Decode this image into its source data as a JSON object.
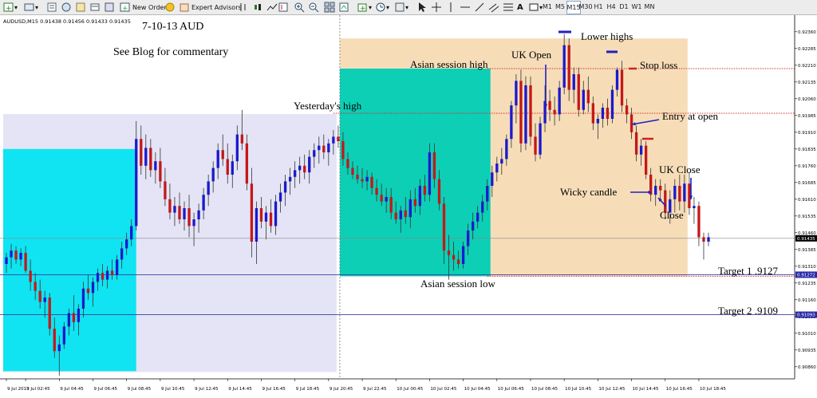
{
  "toolbar": {
    "new_order": "New Order",
    "expert_advisors": "Expert Advisors",
    "timeframes": [
      "M1",
      "M5",
      "M15",
      "M30",
      "H1",
      "H4",
      "D1",
      "W1",
      "MN"
    ],
    "active_timeframe": "M15"
  },
  "chart": {
    "symbol_info": "AUDUSD,M15  0.91438 0.91456 0.91433 0.91435",
    "date_title": "7-10-13  AUD",
    "blog_note": "See Blog for commentary",
    "current_price": "0.91435",
    "target1_price_label": "0.91272",
    "target2_price_label": "0.91093"
  },
  "chart_data": {
    "type": "candlestick",
    "price_axis_ticks": [
      "0.92360",
      "0.92285",
      "0.92210",
      "0.92135",
      "0.92060",
      "0.91985",
      "0.91910",
      "0.91835",
      "0.91760",
      "0.91685",
      "0.91610",
      "0.91535",
      "0.91460",
      "0.91385",
      "0.91310",
      "0.91235",
      "0.91160",
      "0.91085",
      "0.91010",
      "0.90935",
      "0.90860"
    ],
    "time_axis_ticks": [
      "9 Jul 2013",
      "9 Jul 02:45",
      "9 Jul 04:45",
      "9 Jul 06:45",
      "9 Jul 08:45",
      "9 Jul 10:45",
      "9 Jul 12:45",
      "9 Jul 14:45",
      "9 Jul 16:45",
      "9 Jul 18:45",
      "9 Jul 20:45",
      "9 Jul 22:45",
      "10 Jul 00:45",
      "10 Jul 02:45",
      "10 Jul 04:45",
      "10 Jul 06:45",
      "10 Jul 08:45",
      "10 Jul 10:45",
      "10 Jul 12:45",
      "10 Jul 14:45",
      "10 Jul 16:45",
      "10 Jul 18:45"
    ],
    "ylim": [
      0.9082,
      0.9242
    ],
    "bull_color": "#1a1acc",
    "bear_color": "#c41818",
    "levels": {
      "yesterdays_high": 0.91995,
      "asian_high": 0.92195,
      "asian_low": 0.91265,
      "current": 0.91435,
      "target1": 0.91272,
      "target2": 0.91093
    },
    "candles": [
      [
        0.9132,
        0.9137,
        0.9128,
        0.9135
      ],
      [
        0.9135,
        0.9141,
        0.913,
        0.9138
      ],
      [
        0.9138,
        0.914,
        0.9132,
        0.9134
      ],
      [
        0.9134,
        0.9139,
        0.9131,
        0.9137
      ],
      [
        0.9137,
        0.914,
        0.9128,
        0.9129
      ],
      [
        0.9129,
        0.9134,
        0.912,
        0.9124
      ],
      [
        0.9124,
        0.9128,
        0.9116,
        0.912
      ],
      [
        0.912,
        0.9125,
        0.9112,
        0.9115
      ],
      [
        0.9115,
        0.912,
        0.9108,
        0.9117
      ],
      [
        0.9117,
        0.9119,
        0.91,
        0.9103
      ],
      [
        0.9103,
        0.9108,
        0.909,
        0.9093
      ],
      [
        0.9093,
        0.91,
        0.9082,
        0.9096
      ],
      [
        0.9096,
        0.9106,
        0.9094,
        0.9104
      ],
      [
        0.9104,
        0.9112,
        0.91,
        0.911
      ],
      [
        0.911,
        0.9118,
        0.9102,
        0.9106
      ],
      [
        0.9106,
        0.9114,
        0.91,
        0.9112
      ],
      [
        0.9112,
        0.9124,
        0.9108,
        0.9121
      ],
      [
        0.9121,
        0.9127,
        0.9116,
        0.9119
      ],
      [
        0.9119,
        0.9126,
        0.9113,
        0.9124
      ],
      [
        0.9124,
        0.913,
        0.912,
        0.9128
      ],
      [
        0.9128,
        0.9132,
        0.9122,
        0.9125
      ],
      [
        0.9125,
        0.9131,
        0.9121,
        0.9129
      ],
      [
        0.9129,
        0.9134,
        0.9125,
        0.9127
      ],
      [
        0.9127,
        0.9136,
        0.9125,
        0.9134
      ],
      [
        0.9134,
        0.9142,
        0.913,
        0.9139
      ],
      [
        0.9139,
        0.9146,
        0.9136,
        0.9143
      ],
      [
        0.9143,
        0.9152,
        0.914,
        0.9149
      ],
      [
        0.9149,
        0.9196,
        0.9147,
        0.9188
      ],
      [
        0.9188,
        0.9194,
        0.9172,
        0.9176
      ],
      [
        0.9176,
        0.919,
        0.917,
        0.9184
      ],
      [
        0.9184,
        0.9188,
        0.9171,
        0.9174
      ],
      [
        0.9174,
        0.9182,
        0.9168,
        0.9178
      ],
      [
        0.9178,
        0.9184,
        0.9166,
        0.9169
      ],
      [
        0.9169,
        0.9175,
        0.9158,
        0.9161
      ],
      [
        0.9161,
        0.9168,
        0.9152,
        0.9155
      ],
      [
        0.9155,
        0.9162,
        0.9149,
        0.9158
      ],
      [
        0.9158,
        0.9164,
        0.915,
        0.9152
      ],
      [
        0.9152,
        0.916,
        0.9147,
        0.9157
      ],
      [
        0.9157,
        0.9163,
        0.9144,
        0.9149
      ],
      [
        0.9149,
        0.9155,
        0.914,
        0.9152
      ],
      [
        0.9152,
        0.9159,
        0.9146,
        0.9156
      ],
      [
        0.9156,
        0.9166,
        0.9152,
        0.9163
      ],
      [
        0.9163,
        0.9172,
        0.9158,
        0.9169
      ],
      [
        0.9169,
        0.9178,
        0.9164,
        0.9175
      ],
      [
        0.9175,
        0.9186,
        0.917,
        0.9183
      ],
      [
        0.9183,
        0.919,
        0.9176,
        0.9179
      ],
      [
        0.9179,
        0.9186,
        0.9168,
        0.9172
      ],
      [
        0.9172,
        0.9181,
        0.9166,
        0.9178
      ],
      [
        0.9178,
        0.9194,
        0.9174,
        0.919
      ],
      [
        0.919,
        0.9201,
        0.9183,
        0.9186
      ],
      [
        0.9186,
        0.919,
        0.9165,
        0.9168
      ],
      [
        0.9168,
        0.9175,
        0.9135,
        0.9142
      ],
      [
        0.9142,
        0.916,
        0.9132,
        0.9157
      ],
      [
        0.9157,
        0.9162,
        0.9148,
        0.9151
      ],
      [
        0.9151,
        0.9158,
        0.9143,
        0.9155
      ],
      [
        0.9155,
        0.9161,
        0.9146,
        0.9149
      ],
      [
        0.9149,
        0.9163,
        0.9145,
        0.916
      ],
      [
        0.916,
        0.9168,
        0.9155,
        0.9164
      ],
      [
        0.9164,
        0.9172,
        0.9158,
        0.9169
      ],
      [
        0.9169,
        0.9175,
        0.9163,
        0.9171
      ],
      [
        0.9171,
        0.9178,
        0.9166,
        0.9174
      ],
      [
        0.9174,
        0.918,
        0.9168,
        0.9176
      ],
      [
        0.9176,
        0.9181,
        0.917,
        0.9173
      ],
      [
        0.9173,
        0.9183,
        0.9168,
        0.918
      ],
      [
        0.918,
        0.9186,
        0.9175,
        0.9183
      ],
      [
        0.9183,
        0.9189,
        0.9177,
        0.9185
      ],
      [
        0.9185,
        0.919,
        0.9179,
        0.9182
      ],
      [
        0.9182,
        0.9188,
        0.9176,
        0.9186
      ],
      [
        0.9186,
        0.9192,
        0.9181,
        0.9189
      ],
      [
        0.9189,
        0.9194,
        0.9184,
        0.9187
      ],
      [
        0.9187,
        0.9191,
        0.9176,
        0.9179
      ],
      [
        0.9179,
        0.9182,
        0.9172,
        0.9175
      ],
      [
        0.9175,
        0.9178,
        0.917,
        0.9172
      ],
      [
        0.9172,
        0.9176,
        0.9168,
        0.917
      ],
      [
        0.917,
        0.9175,
        0.9166,
        0.9169
      ],
      [
        0.9169,
        0.9174,
        0.9165,
        0.9171
      ],
      [
        0.9171,
        0.9173,
        0.9163,
        0.9166
      ],
      [
        0.9166,
        0.917,
        0.916,
        0.9163
      ],
      [
        0.9163,
        0.9168,
        0.9158,
        0.916
      ],
      [
        0.916,
        0.9166,
        0.9155,
        0.9162
      ],
      [
        0.9162,
        0.9166,
        0.9152,
        0.9155
      ],
      [
        0.9155,
        0.916,
        0.915,
        0.9152
      ],
      [
        0.9152,
        0.9158,
        0.9146,
        0.9156
      ],
      [
        0.9156,
        0.9162,
        0.915,
        0.9153
      ],
      [
        0.9153,
        0.9165,
        0.9148,
        0.9161
      ],
      [
        0.9161,
        0.9166,
        0.9155,
        0.9158
      ],
      [
        0.9158,
        0.917,
        0.9154,
        0.9167
      ],
      [
        0.9167,
        0.9172,
        0.916,
        0.9163
      ],
      [
        0.9163,
        0.9186,
        0.916,
        0.9182
      ],
      [
        0.9182,
        0.9186,
        0.9166,
        0.917
      ],
      [
        0.917,
        0.9174,
        0.9156,
        0.9159
      ],
      [
        0.9159,
        0.9162,
        0.9132,
        0.9138
      ],
      [
        0.9138,
        0.9145,
        0.9125,
        0.9136
      ],
      [
        0.9136,
        0.9142,
        0.9129,
        0.9134
      ],
      [
        0.9134,
        0.9138,
        0.913,
        0.9132
      ],
      [
        0.9132,
        0.9142,
        0.913,
        0.914
      ],
      [
        0.914,
        0.915,
        0.9136,
        0.9147
      ],
      [
        0.9147,
        0.9155,
        0.9143,
        0.9151
      ],
      [
        0.9151,
        0.9158,
        0.9148,
        0.9155
      ],
      [
        0.9155,
        0.9163,
        0.9151,
        0.916
      ],
      [
        0.916,
        0.917,
        0.9156,
        0.9167
      ],
      [
        0.9167,
        0.9176,
        0.9162,
        0.9173
      ],
      [
        0.9173,
        0.918,
        0.9169,
        0.9177
      ],
      [
        0.9177,
        0.9184,
        0.9172,
        0.9179
      ],
      [
        0.9179,
        0.919,
        0.9176,
        0.9188
      ],
      [
        0.9188,
        0.9205,
        0.9184,
        0.9203
      ],
      [
        0.9203,
        0.9217,
        0.9195,
        0.9214
      ],
      [
        0.9214,
        0.9219,
        0.9182,
        0.9186
      ],
      [
        0.9186,
        0.9216,
        0.9183,
        0.9212
      ],
      [
        0.9212,
        0.9216,
        0.9185,
        0.9189
      ],
      [
        0.9189,
        0.9195,
        0.9178,
        0.9181
      ],
      [
        0.9181,
        0.9198,
        0.9179,
        0.9195
      ],
      [
        0.9195,
        0.9212,
        0.9191,
        0.9205
      ],
      [
        0.9205,
        0.921,
        0.9196,
        0.9201
      ],
      [
        0.9201,
        0.9207,
        0.9194,
        0.9199
      ],
      [
        0.9199,
        0.9214,
        0.9196,
        0.9211
      ],
      [
        0.9211,
        0.9235,
        0.9208,
        0.923
      ],
      [
        0.923,
        0.9233,
        0.9205,
        0.921
      ],
      [
        0.921,
        0.922,
        0.9204,
        0.9217
      ],
      [
        0.9217,
        0.922,
        0.9198,
        0.9201
      ],
      [
        0.9201,
        0.9214,
        0.9199,
        0.921
      ],
      [
        0.921,
        0.9216,
        0.92,
        0.9204
      ],
      [
        0.9204,
        0.9207,
        0.9192,
        0.9195
      ],
      [
        0.9195,
        0.9199,
        0.9188,
        0.9197
      ],
      [
        0.9197,
        0.9204,
        0.9193,
        0.9202
      ],
      [
        0.9202,
        0.9206,
        0.9194,
        0.9197
      ],
      [
        0.9197,
        0.9212,
        0.9195,
        0.921
      ],
      [
        0.921,
        0.922,
        0.9207,
        0.9219
      ],
      [
        0.9219,
        0.9223,
        0.92,
        0.9203
      ],
      [
        0.9203,
        0.9206,
        0.9195,
        0.9199
      ],
      [
        0.9199,
        0.9202,
        0.9188,
        0.9191
      ],
      [
        0.9191,
        0.9194,
        0.9178,
        0.9181
      ],
      [
        0.9181,
        0.9188,
        0.9176,
        0.9185
      ],
      [
        0.9185,
        0.9187,
        0.917,
        0.9172
      ],
      [
        0.9172,
        0.9175,
        0.916,
        0.9163
      ],
      [
        0.9163,
        0.917,
        0.9158,
        0.9167
      ],
      [
        0.9167,
        0.917,
        0.916,
        0.9165
      ],
      [
        0.9165,
        0.9168,
        0.9152,
        0.9155
      ],
      [
        0.9155,
        0.9165,
        0.915,
        0.9161
      ],
      [
        0.9161,
        0.917,
        0.9155,
        0.9167
      ],
      [
        0.9167,
        0.9172,
        0.9156,
        0.916
      ],
      [
        0.916,
        0.9172,
        0.9155,
        0.9168
      ],
      [
        0.9168,
        0.9173,
        0.9154,
        0.9157
      ],
      [
        0.9157,
        0.9162,
        0.915,
        0.9158
      ],
      [
        0.9158,
        0.916,
        0.914,
        0.9144
      ],
      [
        0.9144,
        0.9146,
        0.9134,
        0.9142
      ],
      [
        0.9142,
        0.9146,
        0.914,
        0.9144
      ]
    ]
  },
  "annotations": {
    "lower_highs": "Lower highs",
    "uk_open": "UK Open",
    "asian_session_high": "Asian session high",
    "stop_loss": "Stop loss",
    "yesterdays_high": "Yesterday's high",
    "entry_at_open": "Entry at open",
    "uk_close": "UK Close",
    "wicky_candle": "Wicky candle",
    "close": "Close",
    "asian_session_low": "Asian session low",
    "target1": "Target 1  .9127",
    "target2": "Target 2  .9109"
  },
  "colors": {
    "asian_box": "#0ccfb6",
    "uk_box": "#f6ddb8",
    "left_cyan_box": "#10e4f2",
    "prev_day_box": "#e4e4f6",
    "level_dotted": "#d43030",
    "target_line": "#3c3ca0"
  }
}
